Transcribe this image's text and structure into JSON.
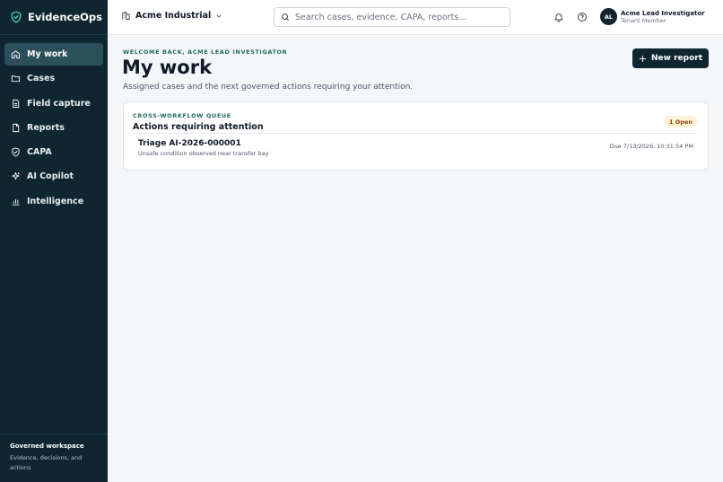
{
  "app": {
    "name": "EvidenceOps"
  },
  "sidebar": {
    "items": [
      {
        "label": "My work",
        "icon": "home-icon",
        "active": true
      },
      {
        "label": "Cases",
        "icon": "folder-icon"
      },
      {
        "label": "Field capture",
        "icon": "clipboard-icon"
      },
      {
        "label": "Reports",
        "icon": "document-icon"
      },
      {
        "label": "CAPA",
        "icon": "shield-check-icon"
      },
      {
        "label": "AI Copilot",
        "icon": "sparkle-icon"
      },
      {
        "label": "Intelligence",
        "icon": "bar-chart-icon"
      }
    ],
    "footer": {
      "title": "Governed workspace",
      "description": "Evidence, decisions, and actions"
    }
  },
  "topbar": {
    "tenant": "Acme Industrial",
    "search": {
      "placeholder": "Search cases, evidence, CAPA, reports..."
    },
    "user": {
      "initials": "AL",
      "name": "Acme Lead Investigator",
      "role": "Tenant Member"
    }
  },
  "main": {
    "eyebrow": "WELCOME BACK, ACME LEAD INVESTIGATOR",
    "title": "My work",
    "subtitle": "Assigned cases and the next governed actions requiring your attention.",
    "new_report_label": "New report",
    "queue": {
      "eyebrow": "CROSS-WORKFLOW QUEUE",
      "title": "Actions requiring attention",
      "badge": "1 Open",
      "items": [
        {
          "title": "Triage AI-2026-000001",
          "description": "Unsafe condition observed near transfer bay",
          "due": "Due 7/13/2026, 10:31:54 PM"
        }
      ]
    }
  },
  "colors": {
    "sidebar_bg": "#0f2530",
    "accent_green": "#1f6b5e",
    "badge_bg": "#fdf1d6",
    "primary_button": "#0f2530"
  }
}
